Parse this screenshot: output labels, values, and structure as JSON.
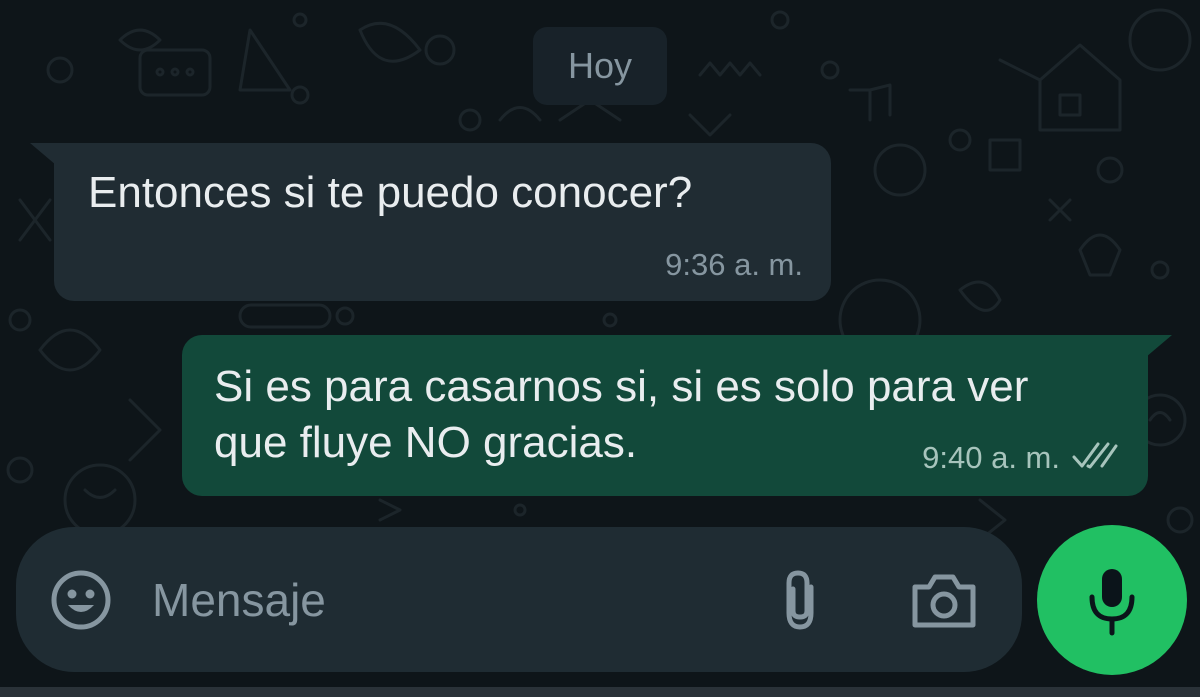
{
  "chat": {
    "date_divider": "Hoy",
    "messages": [
      {
        "direction": "incoming",
        "text": "Entonces si te puedo conocer?",
        "time": "9:36 a. m."
      },
      {
        "direction": "outgoing",
        "text": "Si es para casarnos si, si es solo para ver que fluye NO gracias.",
        "time": "9:40 a. m.",
        "status_icon": "double-check-icon"
      }
    ]
  },
  "composer": {
    "placeholder": "Mensaje",
    "emoji_icon": "emoji-icon",
    "attach_icon": "paperclip-icon",
    "camera_icon": "camera-icon",
    "mic_icon": "microphone-icon"
  },
  "colors": {
    "background": "#0e1519",
    "incoming_bubble": "#202c33",
    "outgoing_bubble": "#12493a",
    "accent": "#21c063"
  }
}
